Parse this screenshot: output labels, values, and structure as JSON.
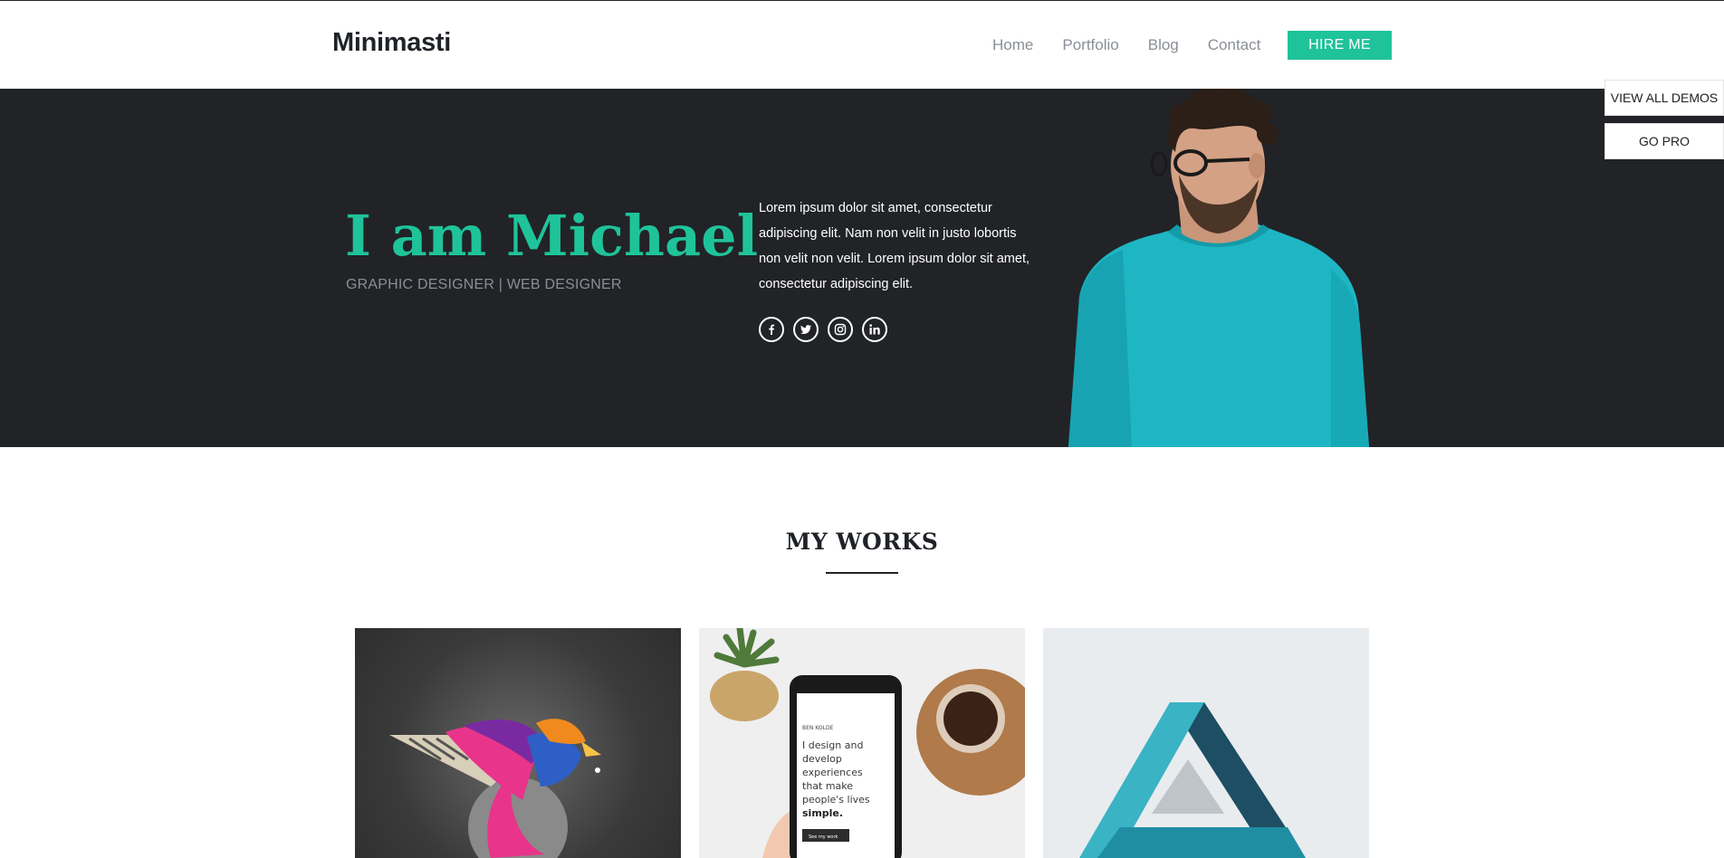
{
  "header": {
    "logo": "Minimasti",
    "nav": [
      "Home",
      "Portfolio",
      "Blog",
      "Contact"
    ],
    "hire_button": "HIRE ME"
  },
  "hero": {
    "title": "I am Michael",
    "subtitle": "GRAPHIC DESIGNER | WEB DESIGNER",
    "text": "Lorem ipsum dolor sit amet, consectetur adipiscing elit. Nam non velit in justo lobortis non velit non velit. Lorem ipsum dolor sit amet, consectetur adipiscing elit.",
    "socials": [
      {
        "icon": "facebook-icon",
        "glyph": "f"
      },
      {
        "icon": "twitter-icon",
        "glyph": "t"
      },
      {
        "icon": "instagram-icon",
        "glyph": "◎"
      },
      {
        "icon": "linkedin-icon",
        "glyph": "in"
      }
    ]
  },
  "side": {
    "demos": "VIEW ALL DEMOS",
    "pro": "GO PRO"
  },
  "works": {
    "title": "MY WORKS",
    "phone_brand": "BEN KOLDE",
    "phone_text": [
      "I design and",
      "develop",
      "experiences",
      "that make",
      "people's lives"
    ],
    "phone_bold": "simple.",
    "phone_button": "See my work"
  },
  "colors": {
    "accent": "#1fc39a",
    "dark": "#212327",
    "muted": "#8a8f96",
    "shirt": "#1fb6c4"
  }
}
